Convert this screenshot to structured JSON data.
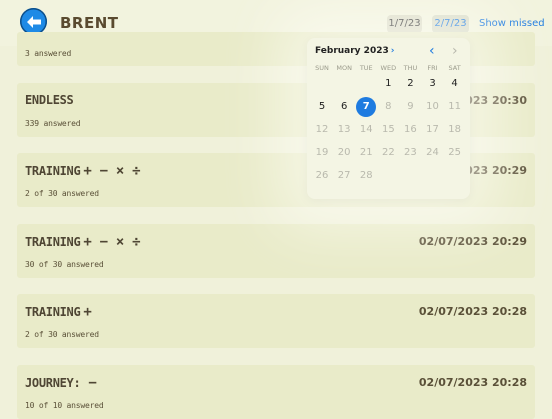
{
  "header": {
    "player_name": "BRENT",
    "date_from": "1/7/23",
    "date_to": "2/7/23",
    "show_missed": "Show missed"
  },
  "sessions": [
    {
      "title": "",
      "ops": "",
      "date": "",
      "answered": "3 answered"
    },
    {
      "title": "ENDLESS",
      "ops": "",
      "date": "2023 20:30",
      "answered": "339 answered"
    },
    {
      "title": "TRAINING",
      "ops": "+ − × ÷",
      "date": "2023 20:29",
      "answered": "2 of 30 answered"
    },
    {
      "title": "TRAINING",
      "ops": "+ − × ÷",
      "date": "02/07/2023 20:29",
      "answered": "30 of 30 answered"
    },
    {
      "title": "TRAINING",
      "ops": "+",
      "date": "02/07/2023 20:28",
      "answered": "2 of 30 answered"
    },
    {
      "title": "JOURNEY:",
      "ops": "−",
      "date": "02/07/2023 20:28",
      "answered": "10 of 10 answered"
    }
  ],
  "calendar": {
    "month_label": "February 2023",
    "weekdays": [
      "SUN",
      "MON",
      "TUE",
      "WED",
      "THU",
      "FRI",
      "SAT"
    ],
    "weeks": [
      [
        "",
        "",
        "",
        "1",
        "2",
        "3",
        "4"
      ],
      [
        "5",
        "6",
        "7",
        "8",
        "9",
        "10",
        "11"
      ],
      [
        "12",
        "13",
        "14",
        "15",
        "16",
        "17",
        "18"
      ],
      [
        "19",
        "20",
        "21",
        "22",
        "23",
        "24",
        "25"
      ],
      [
        "26",
        "27",
        "28",
        "",
        "",
        "",
        ""
      ]
    ],
    "selected_day": "7",
    "last_enabled_day": 7
  },
  "icons": {
    "back": "back-arrow-icon",
    "month_chevron": "chevron-right-icon",
    "prev_month": "chevron-left-icon",
    "next_month": "chevron-right-icon"
  },
  "colors": {
    "accent": "#1e7be0",
    "background": "#f0f1da",
    "card": "#e9ebc9"
  }
}
